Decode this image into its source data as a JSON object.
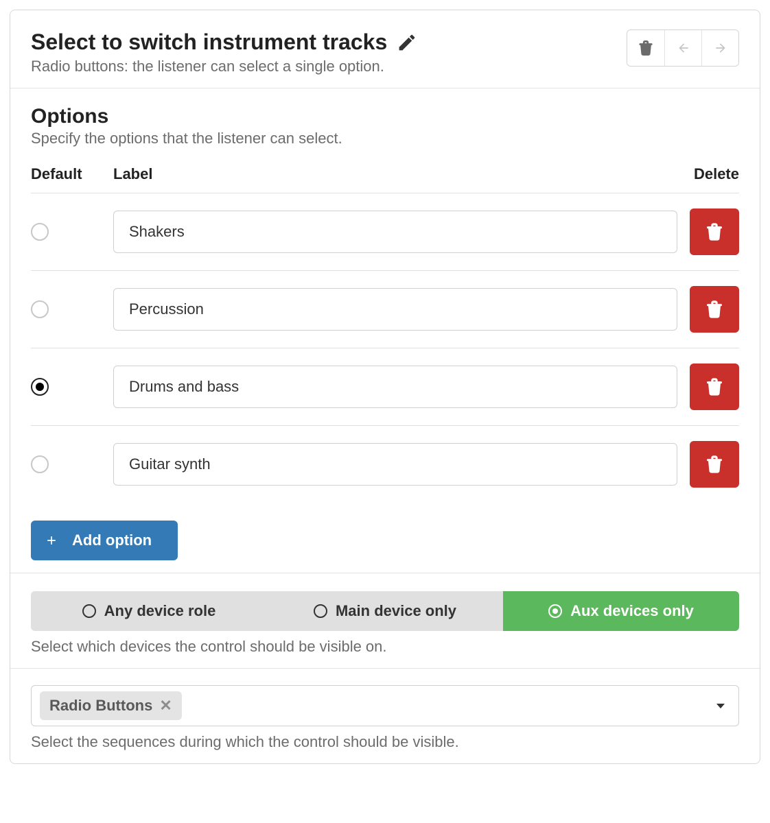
{
  "header": {
    "title": "Select to switch instrument tracks",
    "subtitle": "Radio buttons: the listener can select a single option."
  },
  "options": {
    "heading": "Options",
    "description": "Specify the options that the listener can select.",
    "columns": {
      "default": "Default",
      "label": "Label",
      "delete": "Delete"
    },
    "rows": [
      {
        "id": 0,
        "label": "Shakers",
        "default": false
      },
      {
        "id": 1,
        "label": "Percussion",
        "default": false
      },
      {
        "id": 2,
        "label": "Drums and bass",
        "default": true
      },
      {
        "id": 3,
        "label": "Guitar synth",
        "default": false
      }
    ],
    "add_label": "Add option"
  },
  "device_role": {
    "buttons": [
      {
        "label": "Any device role",
        "selected": false
      },
      {
        "label": "Main device only",
        "selected": false
      },
      {
        "label": "Aux devices only",
        "selected": true
      }
    ],
    "help": "Select which devices the control should be visible on."
  },
  "sequences": {
    "tags": [
      {
        "label": "Radio Buttons"
      }
    ],
    "help": "Select the sequences during which the control should be visible."
  }
}
